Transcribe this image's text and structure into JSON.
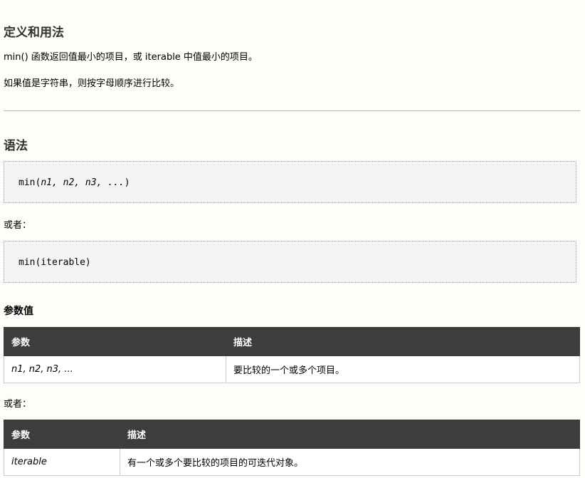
{
  "section1": {
    "title": "定义和用法",
    "para1": "min() 函数返回值最小的项目，或 iterable 中值最小的项目。",
    "para2": "如果值是字符串，则按字母顺序进行比较。"
  },
  "section2": {
    "title": "语法",
    "syntax1": {
      "func": "min(",
      "args": "n1, n2, n3, ...",
      "close": ")"
    },
    "or1": "或者：",
    "syntax2": "min(iterable)"
  },
  "params": {
    "title": "参数值",
    "table1": {
      "headers": [
        "参数",
        "描述"
      ],
      "rows": [
        [
          "n1, n2, n3, ...",
          "要比较的一个或多个项目。"
        ]
      ]
    },
    "or2": "或者：",
    "table2": {
      "headers": [
        "参数",
        "描述"
      ],
      "rows": [
        [
          "iterable",
          "有一个或多个要比较的项目的可迭代对象。"
        ]
      ]
    }
  }
}
